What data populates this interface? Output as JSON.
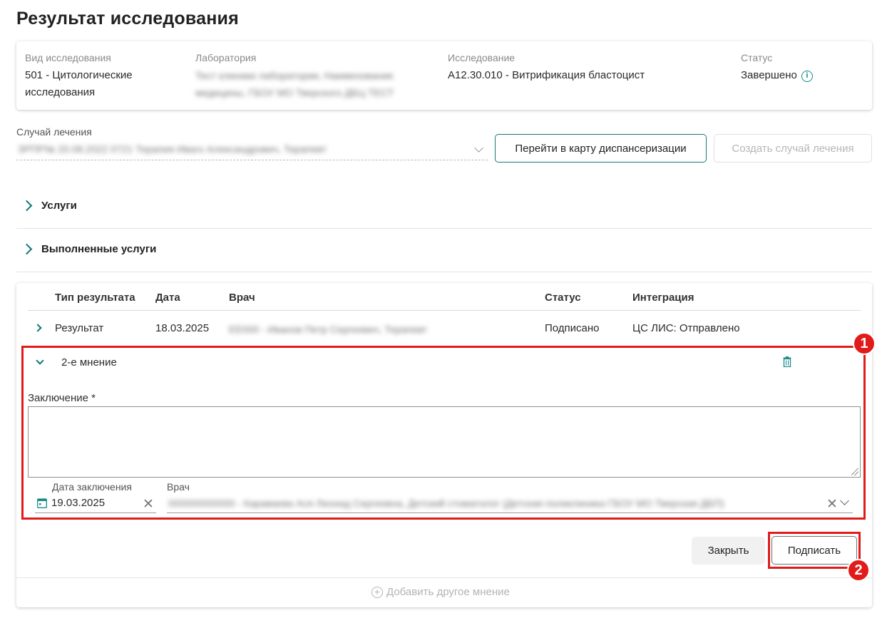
{
  "page_title": "Результат исследования",
  "info": {
    "type_label": "Вид исследования",
    "type_value_line1": "501 - Цитологические",
    "type_value_line2": "исследования",
    "lab_label": "Лаборатория",
    "lab_blur_line1": "Тест клиники лаборатории, Наименование",
    "lab_blur_line2": "медицины, ГБОУ МО Тверского ДБЦ ТЕСТ",
    "research_label": "Исследование",
    "research_value": "A12.30.010 - Витрификация бластоцист",
    "status_label": "Статус",
    "status_value": "Завершено",
    "status_icon": "i"
  },
  "case": {
    "label": "Случай лечения",
    "blur_value": "ЗРПР№ 20.08.2022 0721 Терапия Иваго Александрович, Терапевт",
    "goto_button": "Перейти в карту диспансеризации",
    "create_button": "Создать случай лечения"
  },
  "sections": {
    "services": "Услуги",
    "done_services": "Выполненные услуги"
  },
  "results_table": {
    "headers": {
      "type": "Тип результата",
      "date": "Дата",
      "doctor": "Врач",
      "status": "Статус",
      "integration": "Интеграция"
    },
    "row": {
      "type": "Результат",
      "date": "18.03.2025",
      "doctor_blur": "ЕЕ000 - Иванов Петр Сергеевич, Терапевт",
      "status": "Подписано",
      "integration": "ЦС ЛИС: Отправлено"
    }
  },
  "opinion": {
    "title": "2-е мнение",
    "conclusion_label": "Заключение *",
    "conclusion_value": "",
    "date_label": "Дата заключения",
    "date_value": "19.03.2025",
    "doctor_label": "Врач",
    "doctor_blur": "000000000000 - Караваева Ася Леонид Сергеевна, Детский стоматолог (Детская поликлиника ГБОУ МО Тверская ДБП)"
  },
  "actions": {
    "close_button": "Закрыть",
    "sign_button": "Подписать",
    "add_opinion": "Добавить другое мнение"
  },
  "badges": {
    "one": "1",
    "two": "2"
  },
  "colors": {
    "accent": "#0e7676",
    "highlight": "#e11a1a"
  }
}
